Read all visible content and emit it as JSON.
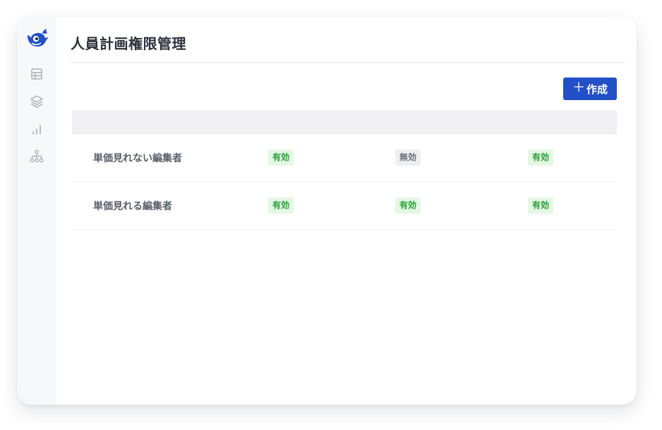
{
  "page": {
    "title": "人員計画権限管理"
  },
  "sidebar": {
    "logo": "whale-logo",
    "items": [
      {
        "icon": "table-icon"
      },
      {
        "icon": "layers-icon"
      },
      {
        "icon": "bar-chart-icon"
      },
      {
        "icon": "org-chart-icon"
      }
    ]
  },
  "toolbar": {
    "create_icon": "＋",
    "create_label": "作成"
  },
  "colors": {
    "brand": "#2250c8",
    "enabled_badge_bg": "#e4f7e3",
    "enabled_badge_text": "#27a236",
    "disabled_badge_bg": "#eeeff2",
    "disabled_badge_text": "#6c707a"
  },
  "table": {
    "columns": [
      "",
      "",
      "",
      ""
    ],
    "rows": [
      {
        "name": "単価見れない編集者",
        "c1": "有効",
        "c2": "無効",
        "c3": "有効"
      },
      {
        "name": "単価見れる編集者",
        "c1": "有効",
        "c2": "有効",
        "c3": "有効"
      }
    ]
  }
}
